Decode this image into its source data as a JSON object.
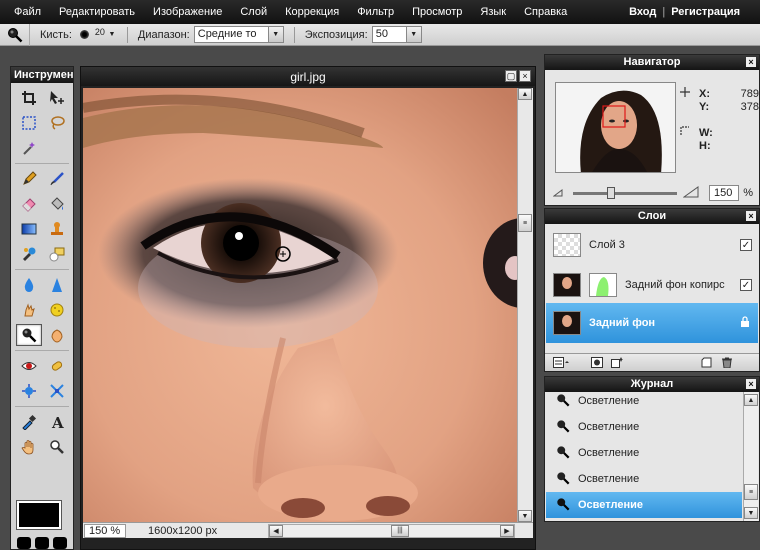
{
  "menu": {
    "items": [
      "Файл",
      "Редактировать",
      "Изображение",
      "Слой",
      "Коррекция",
      "Фильтр",
      "Просмотр",
      "Язык",
      "Справка"
    ],
    "login": "Вход",
    "separator": "|",
    "register": "Регистрация"
  },
  "options": {
    "brush_label": "Кисть:",
    "brush_size": "20",
    "range_label": "Диапазон:",
    "range_value": "Средние то",
    "exposure_label": "Экспозиция:",
    "exposure_value": "50"
  },
  "toolbox": {
    "title": "Инструмент",
    "active_tool": "dodge-burn-tool",
    "foreground_color": "#000000"
  },
  "document": {
    "title": "girl.jpg",
    "zoom": "150 %",
    "dimensions": "1600x1200 px"
  },
  "navigator": {
    "title": "Навигатор",
    "x_label": "X:",
    "x_value": "789",
    "y_label": "Y:",
    "y_value": "378",
    "w_label": "W:",
    "w_value": "",
    "h_label": "H:",
    "h_value": "",
    "zoom": "150",
    "zoom_unit": "%",
    "zoom_slider_fraction": 0.3
  },
  "layers": {
    "title": "Слои",
    "items": [
      {
        "name": "Слой 3",
        "visible": true,
        "selected": false
      },
      {
        "name": "Задний фон копирс",
        "visible": true,
        "selected": false
      },
      {
        "name": "Задний фон",
        "visible": true,
        "selected": true,
        "locked": true
      }
    ]
  },
  "journal": {
    "title": "Журнал",
    "items": [
      "Осветление",
      "Осветление",
      "Осветление",
      "Осветление",
      "Осветление"
    ],
    "selected_index": 4
  },
  "colors": {
    "selection": "#3a9fe3",
    "titlebar": "#1c1c1c",
    "panel_bg": "#e6e6e6"
  }
}
